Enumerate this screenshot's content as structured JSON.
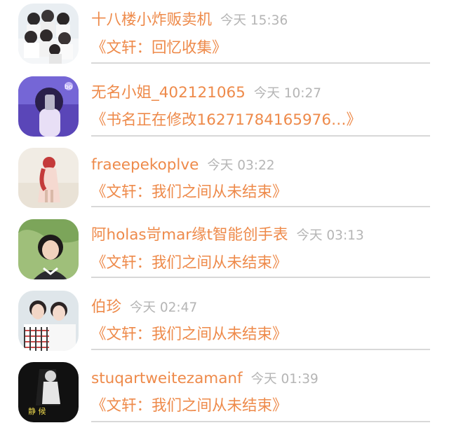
{
  "items": [
    {
      "name": "十八楼小炸贩卖机",
      "time": "今天 15:36",
      "title": "《文轩：回忆收集》",
      "avatar": "group-photo-icon"
    },
    {
      "name": "无名小姐_402121065",
      "time": "今天 10:27",
      "title": "《书名正在修改16271784165976…》",
      "avatar": "purple-selfie-icon"
    },
    {
      "name": "fraeepekoplve",
      "time": "今天 03:22",
      "title": "《文轩：我们之间从未结束》",
      "avatar": "red-dress-girl-icon"
    },
    {
      "name": "阿holas岢mar缘t智能创手表",
      "time": "今天 03:13",
      "title": "《文轩：我们之间从未结束》",
      "avatar": "girl-portrait-icon"
    },
    {
      "name": "伯珍",
      "time": "今天 02:47",
      "title": "《文轩：我们之间从未结束》",
      "avatar": "two-boys-icon"
    },
    {
      "name": "stuqartweitezamanf",
      "time": "今天 01:39",
      "title": "《文轩：我们之间从未结束》",
      "avatar": "dark-poster-icon"
    }
  ],
  "colors": {
    "accent": "#ee8a4a",
    "time": "#b5b5b5",
    "divider": "#d8d8d8"
  }
}
